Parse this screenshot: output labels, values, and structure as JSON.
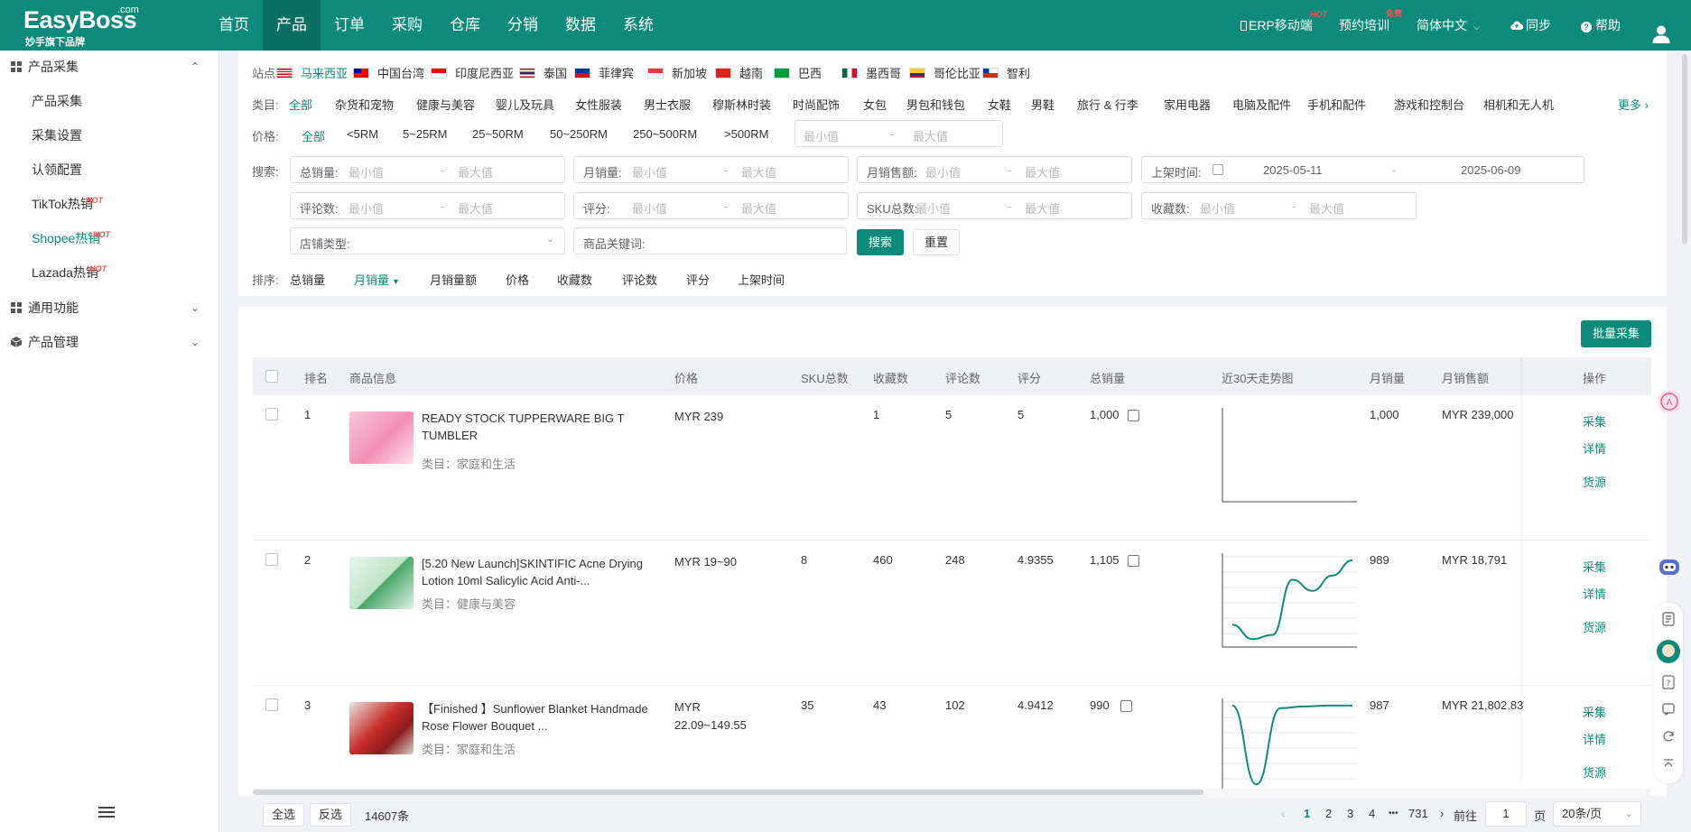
{
  "logo": {
    "main": "EasyBoss",
    "com": ".com",
    "sub": "妙手旗下品牌"
  },
  "nav": [
    "首页",
    "产品",
    "订单",
    "采购",
    "仓库",
    "分销",
    "数据",
    "系统"
  ],
  "top_right": {
    "erp": "ERP移动端",
    "erp_badge": "HOT",
    "training": "预约培训",
    "training_badge": "免费",
    "language": "简体中文",
    "sync": "同步",
    "help": "帮助"
  },
  "sidebar": {
    "group1": "产品采集",
    "items": [
      "产品采集",
      "采集设置",
      "认领配置",
      "TikTok热销",
      "Shopee热销",
      "Lazada热销"
    ],
    "item_badge": "HOT",
    "group2": "通用功能",
    "group3": "产品管理"
  },
  "filter": {
    "site_label": "站点:",
    "sites": [
      {
        "name": "马来西亚",
        "flag": "my"
      },
      {
        "name": "中国台湾",
        "flag": "tw"
      },
      {
        "name": "印度尼西亚",
        "flag": "id"
      },
      {
        "name": "泰国",
        "flag": "th"
      },
      {
        "name": "菲律宾",
        "flag": "ph"
      },
      {
        "name": "新加坡",
        "flag": "sg"
      },
      {
        "name": "越南",
        "flag": "vn"
      },
      {
        "name": "巴西",
        "flag": "br"
      },
      {
        "name": "墨西哥",
        "flag": "mx"
      },
      {
        "name": "哥伦比亚",
        "flag": "co"
      },
      {
        "name": "智利",
        "flag": "cl"
      }
    ],
    "category_label": "类目:",
    "categories": [
      "全部",
      "杂货和宠物",
      "健康与美容",
      "婴儿及玩具",
      "女性服装",
      "男士衣服",
      "穆斯林时装",
      "时尚配饰",
      "女包",
      "男包和钱包",
      "女鞋",
      "男鞋",
      "旅行 & 行李",
      "家用电器",
      "电脑及配件",
      "手机和配件",
      "游戏和控制台",
      "相机和无人机"
    ],
    "more": "更多",
    "price_label": "价格:",
    "prices": [
      "全部",
      "<5RM",
      "5~25RM",
      "25~50RM",
      "50~250RM",
      "250~500RM",
      ">500RM"
    ],
    "min_ph": "最小值",
    "max_ph": "最大值",
    "dash": "-",
    "search_label": "搜索:",
    "fields": {
      "total_sales": "总销量:",
      "monthly_sales": "月销量:",
      "monthly_revenue": "月销售额:",
      "listed_time": "上架时间:",
      "reviews": "评论数:",
      "rating": "评分:",
      "sku_total": "SKU总数:",
      "favorites": "收藏数:"
    },
    "date_from": "2025-05-11",
    "date_to": "2025-06-09",
    "shop_type": "店铺类型:",
    "keyword": "商品关键词:",
    "search_btn": "搜索",
    "reset_btn": "重置",
    "sort_label": "排序:",
    "sorts": [
      "总销量",
      "月销量",
      "月销量额",
      "价格",
      "收藏数",
      "评论数",
      "评分",
      "上架时间"
    ]
  },
  "batch_btn": "批量采集",
  "table": {
    "headers": {
      "rank": "排名",
      "info": "商品信息",
      "price": "价格",
      "sku": "SKU总数",
      "fav": "收藏数",
      "reviews": "评论数",
      "rating": "评分",
      "total_sales": "总销量",
      "trend": "近30天走势图",
      "monthly_sales": "月销量",
      "monthly_revenue": "月销售额",
      "ops": "操作"
    },
    "rows": [
      {
        "rank": "1",
        "name": "READY STOCK TUPPERWARE BIG T TUMBLER",
        "category": "类目：家庭和生活",
        "price": "MYR 239",
        "sku": "",
        "fav": "1",
        "reviews": "5",
        "rating": "5",
        "total_sales": "1,000",
        "monthly_sales": "1,000",
        "monthly_revenue": "MYR 239,000",
        "trend": []
      },
      {
        "rank": "2",
        "name": "[5.20 New Launch]SKINTIFIC Acne Drying Lotion 10ml Salicylic Acid Anti-...",
        "category": "类目：健康与美容",
        "price": "MYR 19~90",
        "sku": "8",
        "fav": "460",
        "reviews": "248",
        "rating": "4.9355",
        "total_sales": "1,105",
        "monthly_sales": "989",
        "monthly_revenue": "MYR 18,791",
        "trend": [
          0.22,
          0.05,
          0.1,
          0.75,
          0.62,
          0.8,
          0.98
        ]
      },
      {
        "rank": "3",
        "name": "【Finished 】Sunflower Blanket Handmade Rose Flower Bouquet ...",
        "category": "类目：家庭和生活",
        "price": "MYR 22.09~149.55",
        "sku": "35",
        "fav": "43",
        "reviews": "102",
        "rating": "4.9412",
        "total_sales": "990",
        "monthly_sales": "987",
        "monthly_revenue": "MYR 21,802.83",
        "trend": [
          0.98,
          0.05,
          0.95,
          0.97,
          0.98,
          0.98
        ]
      }
    ],
    "actions": [
      "采集",
      "详情",
      "货源"
    ]
  },
  "footer": {
    "select_all": "全选",
    "invert": "反选",
    "total": "14607条",
    "pages": [
      "1",
      "2",
      "3",
      "4"
    ],
    "ellipsis": "•••",
    "last": "731",
    "goto": "前往",
    "page_value": "1",
    "page_unit": "页",
    "page_size": "20条/页"
  },
  "colors": {
    "primary": "#0e8a7a",
    "hot": "#ff4d4f"
  }
}
